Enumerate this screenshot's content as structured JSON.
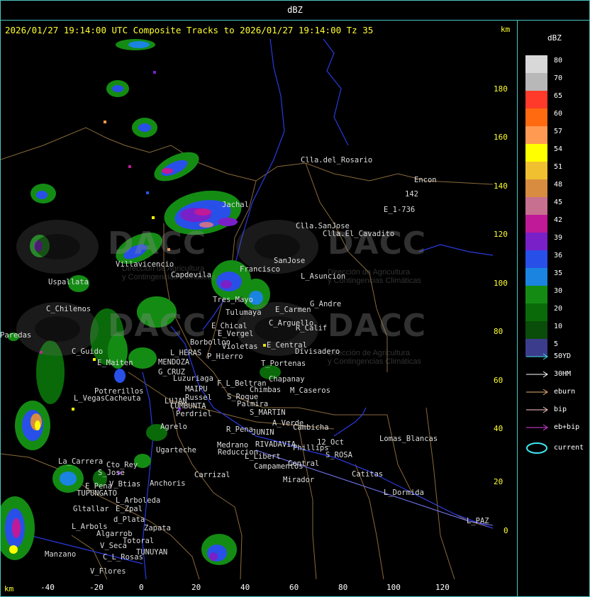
{
  "window_title": "dBZ",
  "header_text": "2026/01/27 19:14:00 UTC Composite Tracks to 2026/01/27 19:14:00 Tz 35",
  "axis_unit": "km",
  "y_ticks": [
    "180",
    "160",
    "140",
    "120",
    "100",
    "80",
    "60",
    "40",
    "20",
    "0"
  ],
  "x_ticks": [
    "-40",
    "-20",
    "0",
    "20",
    "40",
    "60",
    "80",
    "100",
    "120"
  ],
  "watermark": {
    "logo_text": "DACC",
    "subtitle_line1": "Dirección de Agricultura",
    "subtitle_line2": "y Contingencias Climáticas"
  },
  "places": [
    {
      "name": "Clla.del_Rosario"
    },
    {
      "name": "Encon"
    },
    {
      "name": "142"
    },
    {
      "name": "E_1-736"
    },
    {
      "name": "Clla.SanJose"
    },
    {
      "name": "Clla.El_Cavadito"
    },
    {
      "name": "Jachal"
    },
    {
      "name": "Villavicencio"
    },
    {
      "name": "Capdevila"
    },
    {
      "name": "Francisco"
    },
    {
      "name": "SanJose"
    },
    {
      "name": "L_Asuncion"
    },
    {
      "name": "Uspallata"
    },
    {
      "name": "C_Chilenos"
    },
    {
      "name": "Tres_Mayo"
    },
    {
      "name": "Tulumaya"
    },
    {
      "name": "E_Carmen"
    },
    {
      "name": "G_Andre"
    },
    {
      "name": "C_Arguello"
    },
    {
      "name": "R_Calif"
    },
    {
      "name": "E_Chical"
    },
    {
      "name": "E_Vergel"
    },
    {
      "name": "Borbollon"
    },
    {
      "name": "Violetas"
    },
    {
      "name": "P_Hierro"
    },
    {
      "name": "E_Central"
    },
    {
      "name": "Divisadero"
    },
    {
      "name": "Paredas"
    },
    {
      "name": "C_Guido"
    },
    {
      "name": "L_HERAS"
    },
    {
      "name": "MENDOZA"
    },
    {
      "name": "E_Maiten"
    },
    {
      "name": "G_CRUZ"
    },
    {
      "name": "Luzuriaga"
    },
    {
      "name": "T_Portenas"
    },
    {
      "name": "Chapanay"
    },
    {
      "name": "MAIPU"
    },
    {
      "name": "F_L_Beltran"
    },
    {
      "name": "Chimbas"
    },
    {
      "name": "M_Caseros"
    },
    {
      "name": "Potrerillos"
    },
    {
      "name": "Russel"
    },
    {
      "name": "S_Roque"
    },
    {
      "name": "L_Vegas"
    },
    {
      "name": "Cacheuta"
    },
    {
      "name": "LUJAN"
    },
    {
      "name": "Palmira"
    },
    {
      "name": "CUMBUNTA"
    },
    {
      "name": "Perdriel"
    },
    {
      "name": "S_MARTIN"
    },
    {
      "name": "A_Verde"
    },
    {
      "name": "Agrelo"
    },
    {
      "name": "R_Pena"
    },
    {
      "name": "JUNIN"
    },
    {
      "name": "Cambicha"
    },
    {
      "name": "Lomas_Blancas"
    },
    {
      "name": "Ugarteche"
    },
    {
      "name": "Medrano"
    },
    {
      "name": "RIVADAVIA"
    },
    {
      "name": "12_Oct"
    },
    {
      "name": "Reduccion"
    },
    {
      "name": "Phillips"
    },
    {
      "name": "L_Libert"
    },
    {
      "name": "S_ROSA"
    },
    {
      "name": "La_Carrera"
    },
    {
      "name": "Cto_Rey"
    },
    {
      "name": "S_Jose"
    },
    {
      "name": "Campamentos"
    },
    {
      "name": "Central"
    },
    {
      "name": "Catitas"
    },
    {
      "name": "Carrizal"
    },
    {
      "name": "E_Pena"
    },
    {
      "name": "V_Btias"
    },
    {
      "name": "TUPUNGATO"
    },
    {
      "name": "Anchoris"
    },
    {
      "name": "Mirador"
    },
    {
      "name": "L_Dormida"
    },
    {
      "name": "L_Arboleda"
    },
    {
      "name": "Gltallar"
    },
    {
      "name": "E_Zpal"
    },
    {
      "name": "L_Arbols"
    },
    {
      "name": "d_Plata"
    },
    {
      "name": "Zapata"
    },
    {
      "name": "L_PAZ"
    },
    {
      "name": "Algarrob"
    },
    {
      "name": "Totoral"
    },
    {
      "name": "V_Seca"
    },
    {
      "name": "TUNUYAN"
    },
    {
      "name": "Manzano"
    },
    {
      "name": "C_L_Rosas"
    },
    {
      "name": "V_Flores"
    }
  ],
  "legend": {
    "title": "dBZ",
    "scale": [
      {
        "value": "80",
        "color": "#d8d8d8"
      },
      {
        "value": "70",
        "color": "#b8b8b8"
      },
      {
        "value": "65",
        "color": "#ff3a2a"
      },
      {
        "value": "60",
        "color": "#ff6a10"
      },
      {
        "value": "57",
        "color": "#ff9a52"
      },
      {
        "value": "54",
        "color": "#ffff00"
      },
      {
        "value": "51",
        "color": "#f0c030"
      },
      {
        "value": "48",
        "color": "#d88c40"
      },
      {
        "value": "45",
        "color": "#c87090"
      },
      {
        "value": "42",
        "color": "#c01a98"
      },
      {
        "value": "39",
        "color": "#7a20c8"
      },
      {
        "value": "36",
        "color": "#2850e8"
      },
      {
        "value": "35",
        "color": "#1a84e0"
      },
      {
        "value": "30",
        "color": "#148c14"
      },
      {
        "value": "20",
        "color": "#0a6a0a"
      },
      {
        "value": "10",
        "color": "#0a4c0a"
      },
      {
        "value": "5",
        "color": "#3c3c8c"
      }
    ],
    "tracks": [
      {
        "label": "50YD",
        "color": "#40e0e8"
      },
      {
        "label": "30HM",
        "color": "#ffffff"
      },
      {
        "label": "eburn",
        "color": "#e8b070"
      },
      {
        "label": "bip",
        "color": "#ffc8c8"
      },
      {
        "label": "eb+bip",
        "color": "#e040e0"
      },
      {
        "label": "current",
        "color": "#40e8f0"
      }
    ]
  }
}
